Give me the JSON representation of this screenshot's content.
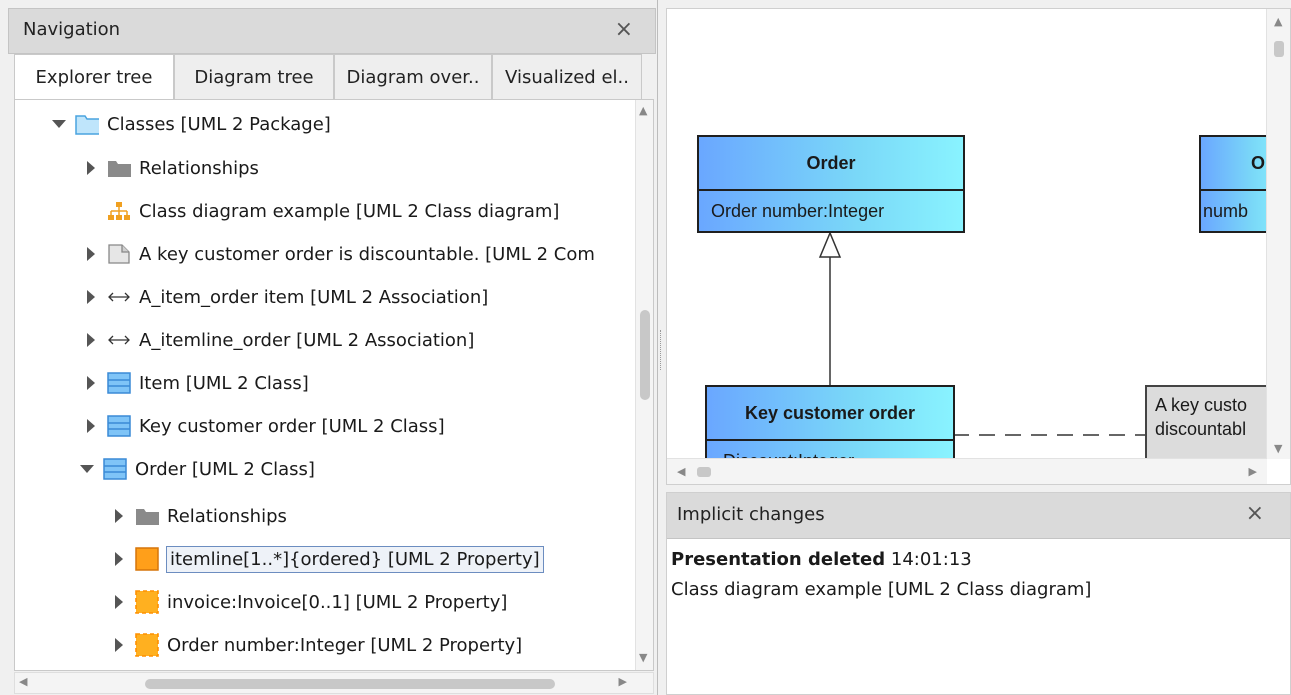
{
  "navigation": {
    "title": "Navigation",
    "close": "×",
    "tabs": [
      {
        "label": "Explorer tree",
        "active": true
      },
      {
        "label": "Diagram tree",
        "active": false
      },
      {
        "label": "Diagram over..",
        "active": false
      },
      {
        "label": "Visualized el..",
        "active": false
      }
    ],
    "tree": [
      {
        "label": "Classes [UML 2 Package]",
        "icon": "package-icon",
        "expanded": true
      },
      {
        "label": "Relationships",
        "icon": "folder-icon",
        "expanded": false
      },
      {
        "label": "Class diagram example [UML 2 Class diagram]",
        "icon": "class-diagram-icon"
      },
      {
        "label": "A key customer order is discountable. [UML 2 Com",
        "icon": "comment-icon",
        "expanded": false
      },
      {
        "label": "A_item_order item [UML 2 Association]",
        "icon": "association-icon",
        "expanded": false
      },
      {
        "label": "A_itemline_order [UML 2 Association]",
        "icon": "association-icon",
        "expanded": false
      },
      {
        "label": "Item [UML 2 Class]",
        "icon": "class-icon",
        "expanded": false
      },
      {
        "label": "Key customer order [UML 2 Class]",
        "icon": "class-icon",
        "expanded": false
      },
      {
        "label": "Order [UML 2 Class]",
        "icon": "class-icon",
        "expanded": true
      },
      {
        "label": "Relationships",
        "icon": "folder-icon",
        "expanded": false
      },
      {
        "label": "itemline[1..*]{ordered} [UML 2 Property]",
        "icon": "property-icon",
        "expanded": false,
        "selected": true
      },
      {
        "label": "invoice:Invoice[0..1] [UML 2 Property]",
        "icon": "property-dashed-icon",
        "expanded": false
      },
      {
        "label": "Order number:Integer [UML 2 Property]",
        "icon": "property-dashed-icon",
        "expanded": false
      }
    ]
  },
  "diagram": {
    "classes": [
      {
        "name": "Order",
        "attribute": "Order number:Integer"
      },
      {
        "name": "O",
        "attribute": "numb"
      },
      {
        "name": "Key customer order",
        "attribute": "Discount:Integer"
      }
    ],
    "note": {
      "line1": "A key custo",
      "line2": "discountabl"
    }
  },
  "implicit_changes": {
    "title": "Implicit changes",
    "close": "×",
    "entry_title": "Presentation deleted",
    "entry_time": "14:01:13",
    "entry_detail": "Class diagram example [UML 2 Class diagram]"
  }
}
